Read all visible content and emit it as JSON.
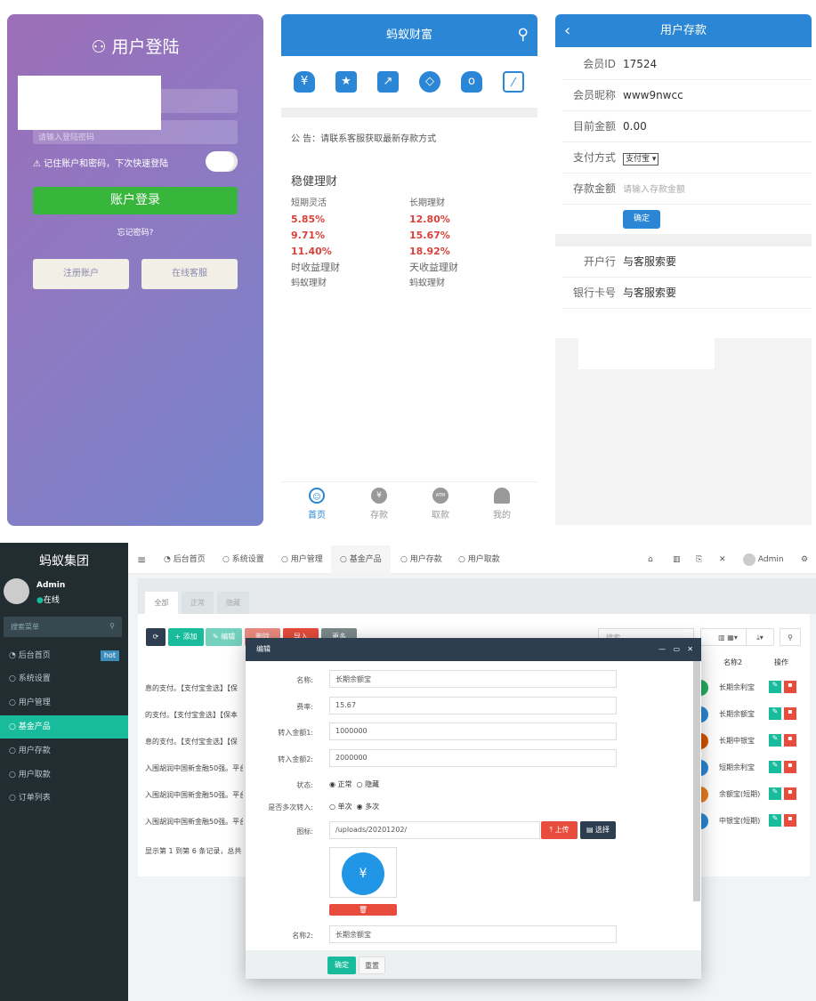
{
  "login": {
    "title": "用户登陆",
    "password_placeholder": "请输入登陆密码",
    "remember": "⚠ 记住账户和密码，下次快速登陆",
    "remember_on": false,
    "login_button": "账户登录",
    "forgot": "忘记密码?",
    "register": "注册账户",
    "service": "在线客服"
  },
  "home": {
    "title": "蚂蚁财富",
    "icons": [
      "money-bag-icon",
      "star-icon",
      "trend-icon",
      "coin-icon",
      "money-bag-2-icon",
      "chart-icon"
    ],
    "notice": "公 告：请联系客服获取最新存款方式",
    "section": "稳健理财",
    "left": {
      "label": "短期灵活",
      "rates": [
        "5.85%",
        "9.71%",
        "11.40%"
      ],
      "type": "时收益理财",
      "brand": "蚂蚁理财"
    },
    "right": {
      "label": "长期理财",
      "rates": [
        "12.80%",
        "15.67%",
        "18.92%"
      ],
      "type": "天收益理财",
      "brand": "蚂蚁理财"
    },
    "nav": [
      {
        "label": "首页",
        "icon": "home-icon",
        "active": true
      },
      {
        "label": "存款",
        "icon": "yuan-icon"
      },
      {
        "label": "取款",
        "icon": "atm-icon"
      },
      {
        "label": "我的",
        "icon": "user-icon"
      }
    ]
  },
  "deposit": {
    "title": "用户存款",
    "rows": [
      {
        "label": "会员ID",
        "value": "17524"
      },
      {
        "label": "会员昵称",
        "value": "www9nwcc"
      },
      {
        "label": "目前金额",
        "value": "0.00"
      }
    ],
    "pay_label": "支付方式",
    "pay_value": "支付宝",
    "amount_label": "存款金额",
    "amount_placeholder": "请输入存款金额",
    "confirm": "确定",
    "bank_rows": [
      {
        "label": "开户行",
        "value": "与客服索要"
      },
      {
        "label": "银行卡号",
        "value": "与客服索要"
      }
    ]
  },
  "admin": {
    "brand": "蚂蚁集团",
    "user": "Admin",
    "status": "在线",
    "search_placeholder": "搜索菜单",
    "menu": [
      {
        "label": "后台首页",
        "badge": "hot"
      },
      {
        "label": "系统设置"
      },
      {
        "label": "用户管理"
      },
      {
        "label": "基金产品",
        "active": true
      },
      {
        "label": "用户存款"
      },
      {
        "label": "用户取款"
      },
      {
        "label": "订单列表"
      }
    ],
    "topnav": [
      "后台首页",
      "系统设置",
      "用户管理",
      "基金产品",
      "用户存款",
      "用户取款"
    ],
    "top_user": "Admin",
    "tabs": [
      "全部",
      "正常",
      "隐藏"
    ],
    "toolbar": {
      "add": "+ 添加",
      "edit": "✎ 编辑",
      "delete": "删除",
      "import": "导入",
      "more": "更多",
      "search_placeholder": "搜索"
    },
    "table": {
      "headers": [
        "名称2",
        "操作"
      ],
      "rows": [
        {
          "desc": "息的支付。【支付宝金选】【保",
          "name2": "长期余利宝",
          "color": "#27ae60"
        },
        {
          "desc": "的支付。【支付宝金选】【保本",
          "name2": "长期余额宝",
          "color": "#2b87d6"
        },
        {
          "desc": "息的支付。【支付宝金选】【保",
          "name2": "长期中银宝",
          "color": "#d35400"
        },
        {
          "desc": "入围胡润中国新金融50强。平台",
          "name2": "短期余利宝",
          "color": "#2b87d6"
        },
        {
          "desc": "入围胡润中国新金融50强。平台",
          "name2": "余额宝(短期)",
          "color": "#e67e22"
        },
        {
          "desc": "入围胡润中国新金融50强。平台",
          "name2": "中银宝(短期)",
          "color": "#2b87d6"
        }
      ],
      "footer": "显示第 1 到第 6 条记录，总共"
    },
    "modal": {
      "title": "编辑",
      "fields": [
        {
          "label": "名称:",
          "value": "长期余额宝"
        },
        {
          "label": "费率:",
          "value": "15.67"
        },
        {
          "label": "转入金额1:",
          "value": "1000000"
        },
        {
          "label": "转入金额2:",
          "value": "2000000"
        }
      ],
      "status_label": "状态:",
      "status_options": [
        "正常",
        "隐藏"
      ],
      "status_selected": "正常",
      "multi_label": "是否多次转入:",
      "multi_options": [
        "单次",
        "多次"
      ],
      "multi_selected": "多次",
      "icon_label": "图标:",
      "icon_value": "/uploads/20201202/",
      "upload": "上传",
      "choose": "选择",
      "name2_label": "名称2:",
      "name2_value": "长期余额宝",
      "submit": "确定",
      "reset": "重置"
    }
  }
}
